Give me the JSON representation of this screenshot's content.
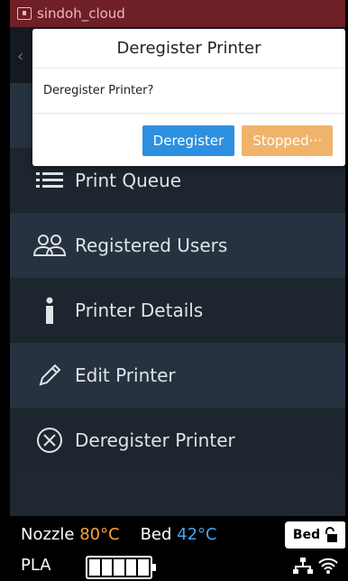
{
  "titlebar": {
    "app_name": "sindoh_cloud"
  },
  "menu": {
    "items": [
      {
        "label": "Print Queue",
        "icon": "list-icon"
      },
      {
        "label": "Registered Users",
        "icon": "users-icon"
      },
      {
        "label": "Printer Details",
        "icon": "info-icon"
      },
      {
        "label": "Edit Printer",
        "icon": "pencil-icon"
      },
      {
        "label": "Deregister Printer",
        "icon": "circle-x-icon"
      }
    ]
  },
  "dialog": {
    "title": "Deregister Printer",
    "message": "Deregister Printer?",
    "confirm_label": "Deregister",
    "status_label": "Stopped···"
  },
  "status": {
    "nozzle_label": "Nozzle",
    "nozzle_temp": "80°C",
    "bed_label": "Bed",
    "bed_temp": "42°C",
    "bed_button_label": "Bed",
    "material": "PLA",
    "battery_level": 1.0
  },
  "colors": {
    "nozzle": "#f5a23c",
    "bed": "#44a6ef",
    "confirm": "#2c8fdf",
    "status_btn": "#f0b36a",
    "titlebar": "#6e2026"
  }
}
